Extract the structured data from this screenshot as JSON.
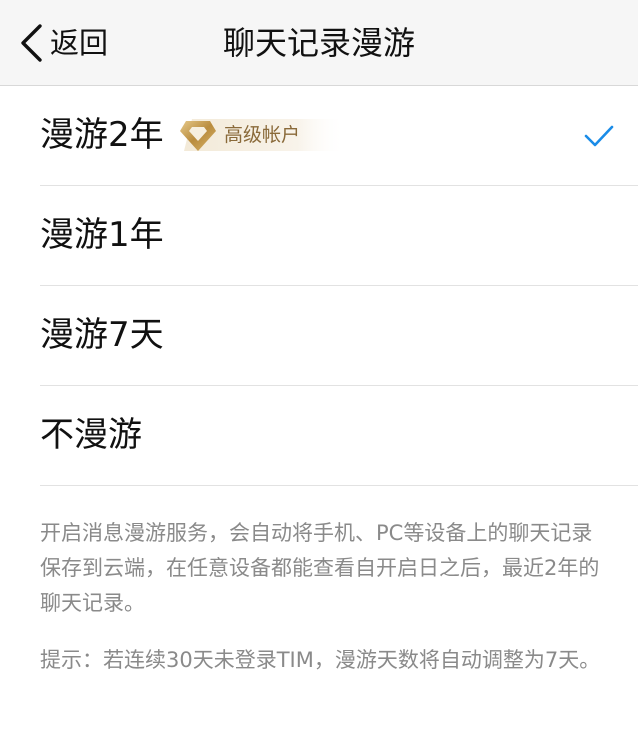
{
  "nav": {
    "back_label": "返回",
    "title": "聊天记录漫游"
  },
  "options": [
    {
      "label": "漫游2年",
      "badge": "高级帐户",
      "selected": true
    },
    {
      "label": "漫游1年"
    },
    {
      "label": "漫游7天"
    },
    {
      "label": "不漫游"
    }
  ],
  "description": "开启消息漫游服务，会自动将手机、PC等设备上的聊天记录保存到云端，在任意设备都能查看自开启日之后，最近2年的聊天记录。",
  "tip": "提示：若连续30天未登录TIM，漫游天数将自动调整为7天。",
  "colors": {
    "accent": "#1a8ce8",
    "badge_gold": "#c9a15a",
    "secondary_text": "#8a8a8a"
  },
  "icons": {
    "back": "chevron-left-icon",
    "selected": "checkmark-icon",
    "badge": "diamond-icon"
  }
}
